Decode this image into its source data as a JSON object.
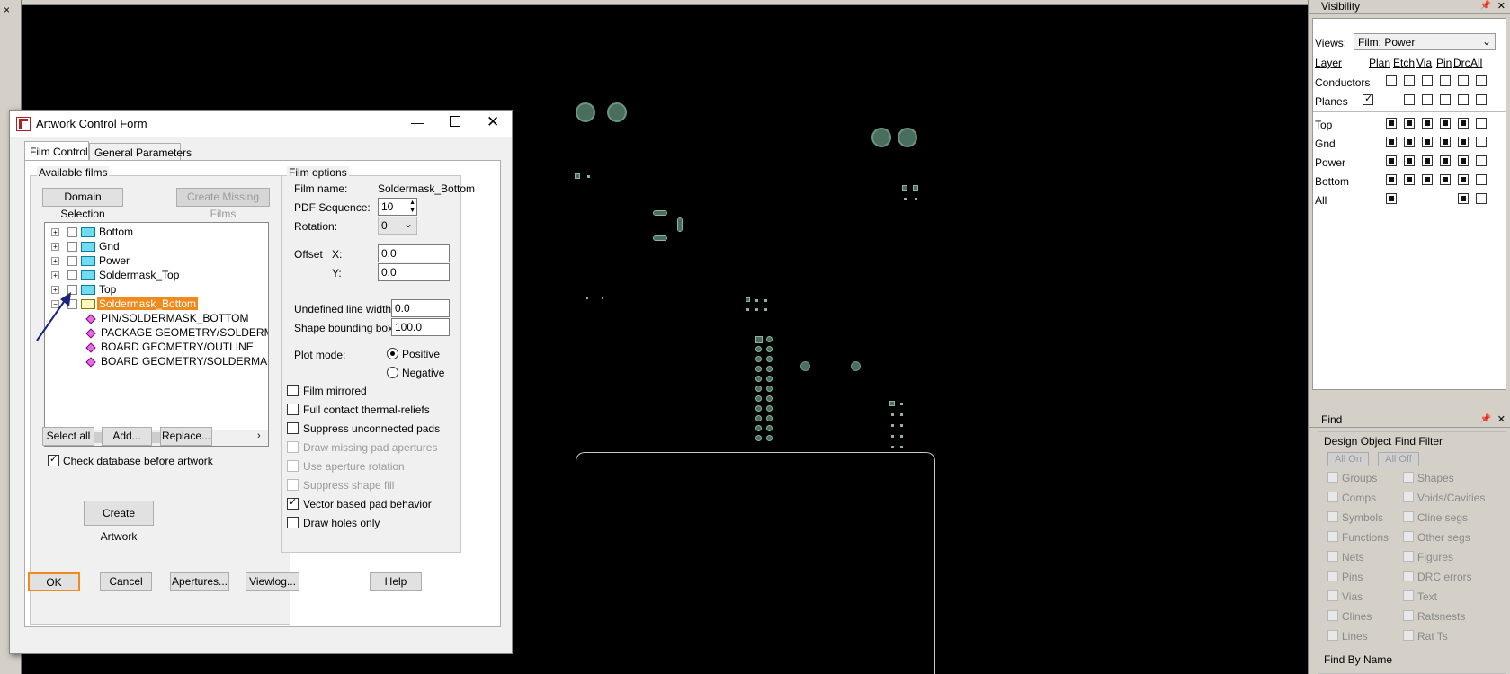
{
  "left_close": "×",
  "dialog": {
    "title": "Artwork Control Form",
    "tabs": [
      "Film Control",
      "General Parameters"
    ],
    "available_films_label": "Available films",
    "domain_selection": "Domain Selection",
    "create_missing_films": "Create Missing Films",
    "tree": {
      "folders": [
        "Bottom",
        "Gnd",
        "Power",
        "Soldermask_Top",
        "Top"
      ],
      "expanded_folder": "Soldermask_Bottom",
      "children": [
        "PIN/SOLDERMASK_BOTTOM",
        "PACKAGE GEOMETRY/SOLDERMAS",
        "BOARD GEOMETRY/OUTLINE",
        "BOARD GEOMETRY/SOLDERMASK_"
      ]
    },
    "select_all": "Select all",
    "add": "Add...",
    "replace": "Replace...",
    "check_database": "Check database before artwork",
    "create_artwork": "Create Artwork",
    "film_options": {
      "label": "Film options",
      "film_name_label": "Film name:",
      "film_name_value": "Soldermask_Bottom",
      "pdf_sequence_label": "PDF Sequence:",
      "pdf_sequence_value": "10",
      "rotation_label": "Rotation:",
      "rotation_value": "0",
      "offset_label": "Offset",
      "x_label": "X:",
      "x_value": "0.0",
      "y_label": "Y:",
      "y_value": "0.0",
      "undef_line_label": "Undefined line width:",
      "undef_line_value": "0.0",
      "shape_bbox_label": "Shape bounding box:",
      "shape_bbox_value": "100.0",
      "plot_mode_label": "Plot mode:",
      "positive": "Positive",
      "negative": "Negative",
      "film_mirrored": "Film mirrored",
      "full_contact": "Full contact thermal-reliefs",
      "suppress_unconnected": "Suppress unconnected pads",
      "draw_missing": "Draw missing pad apertures",
      "use_aperture": "Use aperture rotation",
      "suppress_shape": "Suppress shape fill",
      "vector_based": "Vector based pad behavior",
      "draw_holes": "Draw holes only"
    },
    "ok": "OK",
    "cancel": "Cancel",
    "apertures": "Apertures...",
    "viewlog": "Viewlog...",
    "help": "Help"
  },
  "visibility": {
    "title": "Visibility",
    "views_label": "Views:",
    "views_value": "Film: Power",
    "headers": [
      "Layer",
      "Plan",
      "Etch",
      "Via",
      "Pin",
      "Drc",
      "All"
    ],
    "rows_top": [
      "Conductors",
      "Planes"
    ],
    "rows": [
      "Top",
      "Gnd",
      "Power",
      "Bottom",
      "All"
    ]
  },
  "find": {
    "title": "Find",
    "filter_label": "Design Object Find Filter",
    "all_on": "All On",
    "all_off": "All Off",
    "left": [
      "Groups",
      "Comps",
      "Symbols",
      "Functions",
      "Nets",
      "Pins",
      "Vias",
      "Clines",
      "Lines"
    ],
    "right": [
      "Shapes",
      "Voids/Cavities",
      "Cline segs",
      "Other segs",
      "Figures",
      "DRC errors",
      "Text",
      "Ratsnests",
      "Rat Ts"
    ],
    "find_by_name": "Find By Name"
  }
}
